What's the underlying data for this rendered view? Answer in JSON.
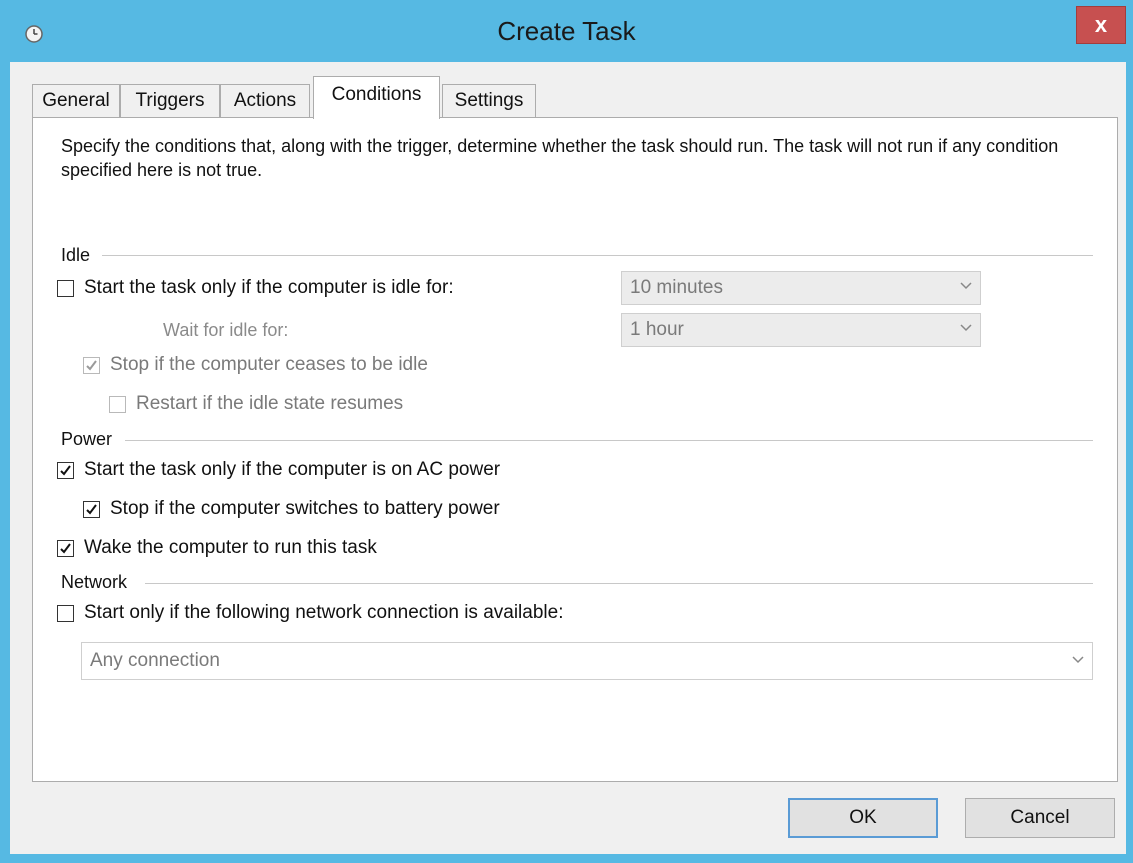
{
  "window": {
    "title": "Create Task",
    "close_label": "x"
  },
  "tabs": [
    {
      "label": "General"
    },
    {
      "label": "Triggers"
    },
    {
      "label": "Actions"
    },
    {
      "label": "Conditions",
      "active": true
    },
    {
      "label": "Settings"
    }
  ],
  "description": "Specify the conditions that, along with the trigger, determine whether the task should run.  The task will not run  if any condition specified here is not true.",
  "idle": {
    "group_label": "Idle",
    "start_if_idle": {
      "label": "Start the task only if the computer is idle for:",
      "checked": false
    },
    "idle_duration": {
      "value": "10 minutes"
    },
    "wait_label": "Wait for idle for:",
    "wait_duration": {
      "value": "1 hour"
    },
    "stop_if_ceases": {
      "label": "Stop if the computer ceases to be idle",
      "checked": true
    },
    "restart_if_resumes": {
      "label": "Restart if the idle state resumes",
      "checked": false
    }
  },
  "power": {
    "group_label": "Power",
    "ac_power": {
      "label": "Start the task only if the computer is on AC power",
      "checked": true
    },
    "battery_stop": {
      "label": "Stop if the computer switches to battery power",
      "checked": true
    },
    "wake": {
      "label": "Wake the computer to run this task",
      "checked": true
    }
  },
  "network": {
    "group_label": "Network",
    "start_if_network": {
      "label": "Start only if the following network connection is available:",
      "checked": false
    },
    "connection": {
      "value": "Any connection"
    }
  },
  "buttons": {
    "ok": "OK",
    "cancel": "Cancel"
  },
  "colors": {
    "titlebar": "#56b9e3",
    "close": "#c75050",
    "default_button_border": "#5a9bd5"
  },
  "icons": {
    "app": "clock-icon",
    "dropdown": "chevron-down-icon",
    "check": "checkmark-icon"
  }
}
